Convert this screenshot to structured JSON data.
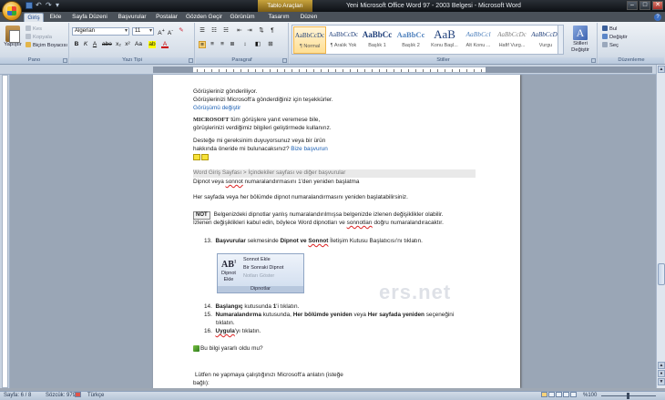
{
  "window": {
    "title": "Yeni Microsoft Office Word 97 - 2003 Belgesi - Microsoft Word",
    "contextual_tab_group": "Tablo Araçları",
    "controls": [
      "–",
      "□",
      "✕"
    ]
  },
  "ribbon_tabs": [
    "Giriş",
    "Ekle",
    "Sayfa Düzeni",
    "Başvurular",
    "Postalar",
    "Gözden Geçir",
    "Görünüm",
    "Tasarım",
    "Düzen"
  ],
  "clipboard": {
    "paste_label": "Yapıştır",
    "cut_label": "Kes",
    "copy_label": "Kopyala",
    "format_painter_label": "Biçim Boyacısı",
    "group_label": "Pano"
  },
  "font": {
    "font_name": "Algerian",
    "font_size": "11",
    "group_label": "Yazı Tipi"
  },
  "paragraph": {
    "group_label": "Paragraf"
  },
  "styles": {
    "items": [
      {
        "sample": "AaBbCcDc",
        "name": "¶ Normal"
      },
      {
        "sample": "AaBbCcDc",
        "name": "¶ Aralık Yok"
      },
      {
        "sample": "AaBbCc",
        "name": "Başlık 1"
      },
      {
        "sample": "AaBbCc",
        "name": "Başlık 2"
      },
      {
        "sample": "AaB",
        "name": "Konu Başl..."
      },
      {
        "sample": "AaBbCcl",
        "name": "Alt Konu ..."
      },
      {
        "sample": "AaBbCcDc",
        "name": "Hafif Vurg..."
      },
      {
        "sample": "AaBbCcDc",
        "name": "Vurgu"
      }
    ],
    "change_styles_label": "Stilleri Değiştir",
    "group_label": "Stiller"
  },
  "editing": {
    "find_label": "Bul",
    "replace_label": "Değiştir",
    "select_label": "Seç",
    "group_label": "Düzenleme"
  },
  "document": {
    "lines": {
      "l1": "Görüşleriniz gönderiliyor.",
      "l2": "Görüşlerinizi Microsoft'a gönderdiğiniz için teşekkürler.",
      "l3": "Görüşümü değiştir",
      "l4_bold": "MICROSOFT",
      "l4_rest": " tüm görüşlere yanıt veremese bile,",
      "l5": "görüşlerinizi verdiğimiz bilgileri geliştirmede kullanırız.",
      "l6": "Desteğe mi gereksinim duyuyorsunuz veya bir ürün",
      "l7_text": "hakkında öneride mi bulunacaksınız? ",
      "l7_link": "Bize başvurun",
      "breadcrumb": "Word Giriş Sayfası > İçindekiler sayfası ve diğer başvurular",
      "l9_a": "Dipnot veya ",
      "l9_b": "sonnot",
      "l9_c": " numaralandırmasını 1'den yeniden başlatma",
      "l10": "Her sayfada veya her bölümde dipnot numaralandırmasını yeniden başlatabilirsiniz.",
      "note_tag": "NOT",
      "note_1": "Belgenizdeki dipnotlar yanlış numaralandırılmışsa belgenizde izlenen değişiklikler olabilir.",
      "note_2a": "İzlenen değişiklikleri kabul edin, böylece Word dipnotları ve ",
      "note_2b": "sonnotları",
      "note_2c": " doğru numaralandıracaktır.",
      "step13_num": "13.",
      "step13_a": "Başvurular",
      "step13_b": " sekmesinde ",
      "step13_c": "Dipnot ve ",
      "step13_d": "Sonnot",
      "step13_e": " İletişim Kutusu Başlatıcısı'nı tıklatın.",
      "step14_num": "14.",
      "step14_a": "Başlangıç",
      "step14_b": " kutusunda ",
      "step14_c": "1",
      "step14_d": "'i tıklatın.",
      "step15_num": "15.",
      "step15_a": "Numaralandırma",
      "step15_b": " kutusunda, ",
      "step15_c": "Her bölümde yeniden",
      "step15_d": " veya ",
      "step15_e": "Her sayfada yeniden",
      "step15_f": " seçeneğini",
      "step15_g": "tıklatın.",
      "step16_num": "16.",
      "step16_a": "Uygula",
      "step16_b": "'yı tıklatın.",
      "helpful": "Bu bilgi yararlı oldu mu?",
      "feedback_1": "Lütfen ne yapmaya çalıştığınızı Microsoft'a anlatın (isteğe",
      "feedback_2": "bağlı):"
    },
    "footnote_image": {
      "ab": "AB",
      "ab_sup": "1",
      "insert_footnote": "Dipnot Ekle",
      "insert_endnote": "Sonnot Ekle",
      "next_footnote": "Bir Sonraki Dipnot",
      "show_notes": "Notları Göster",
      "group": "Dipnotlar"
    },
    "watermark": "ers.net"
  },
  "statusbar": {
    "page": "Sayfa: 6 / 8",
    "words": "Sözcük: 979",
    "language": "Türkçe",
    "zoom": "%100"
  }
}
